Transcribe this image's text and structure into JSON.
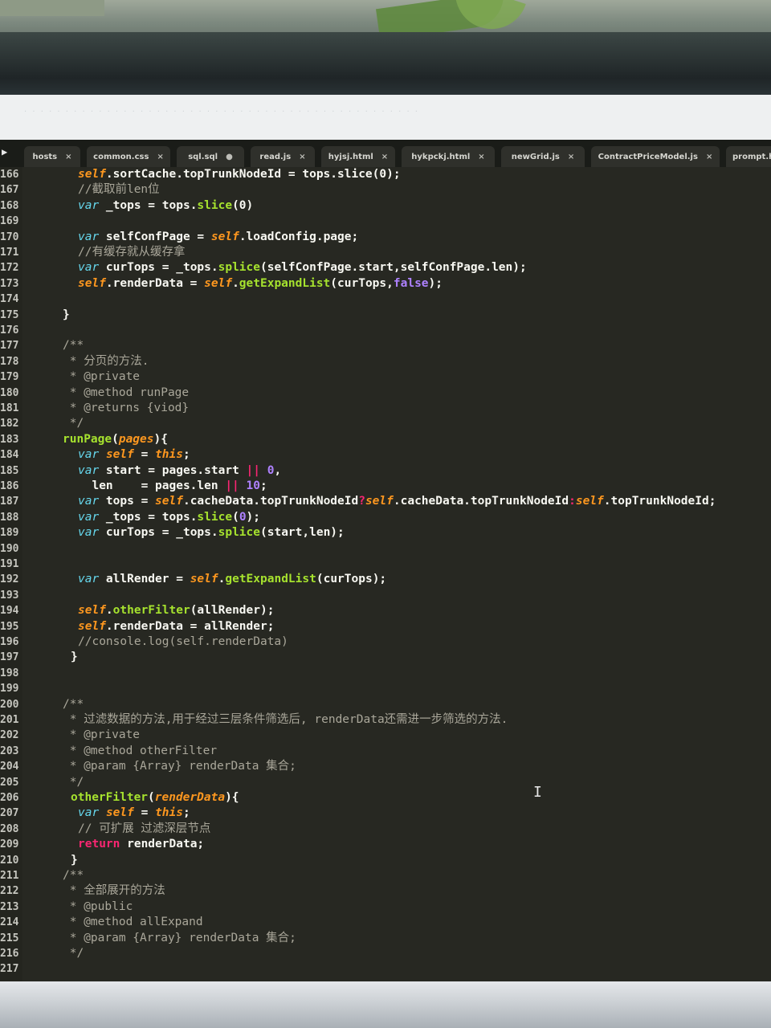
{
  "tabs": [
    {
      "label": "hosts",
      "close": "×"
    },
    {
      "label": "common.css",
      "close": "×"
    },
    {
      "label": "sql.sql",
      "close": "●"
    },
    {
      "label": "read.js",
      "close": "×"
    },
    {
      "label": "hyjsj.html",
      "close": "×"
    },
    {
      "label": "hykpckj.html",
      "close": "×"
    },
    {
      "label": "newGrid.js",
      "close": "×"
    },
    {
      "label": "ContractPriceModel.js",
      "close": "×"
    },
    {
      "label": "prompt.h",
      "close": ""
    }
  ],
  "tab_arrow": "▶",
  "menubar_text": "· · · · · · · · · · · · · · · · · · · · · · · · · · · · · · · · · · · · · · · · · · · · · · · ·",
  "line_numbers": [
    "166",
    "167",
    "168",
    "169",
    "170",
    "171",
    "172",
    "173",
    "174",
    "175",
    "176",
    "177",
    "178",
    "179",
    "180",
    "181",
    "182",
    "183",
    "184",
    "185",
    "186",
    "187",
    "188",
    "189",
    "190",
    "191",
    "192",
    "193",
    "194",
    "195",
    "196",
    "197",
    "198",
    "199",
    "200",
    "201",
    "202",
    "203",
    "204",
    "205",
    "206",
    "207",
    "208",
    "209",
    "210",
    "211",
    "212",
    "213",
    "214",
    "215",
    "216",
    "217"
  ],
  "code_tokens": {
    "l166": [
      "self",
      ".sortCache.topTrunkNodeId = tops.slice(0);"
    ],
    "l167": "//截取前len位",
    "l168": [
      "var",
      " _tops = tops.",
      "slice",
      "(0)"
    ],
    "l170": [
      "var",
      " selfConfPage = ",
      "self",
      ".loadConfig.page;"
    ],
    "l171": "//有缓存就从缓存拿",
    "l172": [
      "var",
      " curTops = _tops.",
      "splice",
      "(selfConfPage.start,selfConfPage.len);"
    ],
    "l173": [
      "self",
      ".renderData = ",
      "self",
      ".",
      "getExpandList",
      "(curTops,",
      "false",
      ");"
    ],
    "l175": "}",
    "l177": "/**",
    "l178": " * 分页的方法.",
    "l179": " * @private",
    "l180": " * @method runPage",
    "l181": " * @returns {viod}",
    "l182": " */",
    "l183": [
      "runPage",
      "(",
      "pages",
      "){"
    ],
    "l184": [
      "var",
      " ",
      "self",
      " = ",
      "this",
      ";"
    ],
    "l185": [
      "var",
      " start = pages.start ",
      "||",
      " ",
      "0",
      ","
    ],
    "l186": [
      "  len    = pages.len ",
      "||",
      " ",
      "10",
      ";"
    ],
    "l187": [
      "var",
      " tops = ",
      "self",
      ".cacheData.topTrunkNodeId",
      "?",
      "self",
      ".cacheData.topTrunkNodeId",
      ":",
      "self",
      ".topTrunkNodeId;"
    ],
    "l188": [
      "var",
      " _tops = tops.",
      "slice",
      "(",
      "0",
      ");"
    ],
    "l189": [
      "var",
      " curTops = _tops.",
      "splice",
      "(start,len);"
    ],
    "l192": [
      "var",
      " allRender = ",
      "self",
      ".",
      "getExpandList",
      "(curTops);"
    ],
    "l194": [
      "self",
      ".",
      "otherFilter",
      "(allRender);"
    ],
    "l195": [
      "self",
      ".renderData = allRender;"
    ],
    "l196": "//console.log(self.renderData)",
    "l197": "}",
    "l200": "/**",
    "l201": " * 过滤数据的方法,用于经过三层条件筛选后, renderData还需进一步筛选的方法.",
    "l202": " * @private",
    "l203": " * @method otherFilter",
    "l204": " * @param {Array} renderData 集合;",
    "l205": " */",
    "l206": [
      "otherFilter",
      "(",
      "renderData",
      "){"
    ],
    "l207": [
      "var",
      " ",
      "self",
      " = ",
      "this",
      ";"
    ],
    "l208": "// 可扩展 过滤深层节点",
    "l209": [
      "return",
      " renderData;"
    ],
    "l210": "}",
    "l211": "/**",
    "l212": " * 全部展开的方法",
    "l213": " * @public",
    "l214": " * @method allExpand",
    "l215": " * @param {Array} renderData 集合;",
    "l216": " */"
  },
  "colors": {
    "background": "#272822",
    "keyword": "#66d9ef",
    "self": "#fd971f",
    "function": "#a6e22e",
    "comment": "#aaa79a",
    "number": "#ae81ff",
    "operator": "#f92672"
  }
}
